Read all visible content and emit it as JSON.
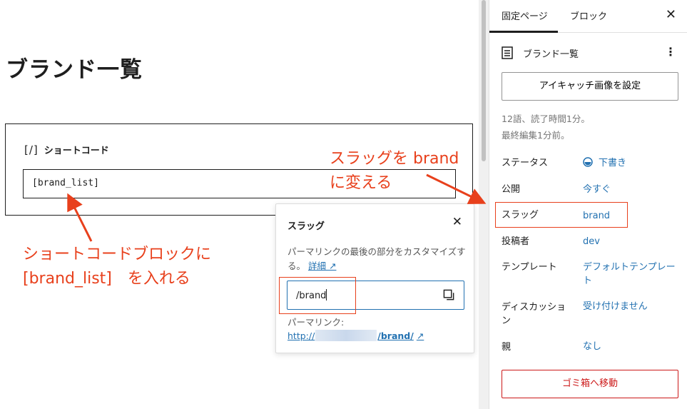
{
  "editor": {
    "page_title": "ブランド一覧",
    "shortcode_block": {
      "icon_text": "[/]",
      "label": "ショートコード",
      "value": "[brand_list]"
    }
  },
  "annotations": {
    "slug_note_line1": "スラッグを brand",
    "slug_note_line2": "に変える",
    "shortcode_note_line1": "ショートコードブロックに",
    "shortcode_note_line2": "[brand_list]　を入れる",
    "color": "#e8401c"
  },
  "slug_popover": {
    "title": "スラッグ",
    "close_icon": "close-icon",
    "description": "パーマリンクの最後の部分をカスタマイズする。",
    "details_link": "詳細 ↗",
    "input_value": "/brand",
    "permalink_label": "パーマリンク:",
    "permalink_prefix": "http://",
    "permalink_suffix": "/brand/",
    "external_arrow": "↗"
  },
  "sidebar": {
    "tabs": [
      "固定ページ",
      "ブロック"
    ],
    "active_tab": "固定ページ",
    "doc_title": "ブランド一覧",
    "featured_image_button": "アイキャッチ画像を設定",
    "word_count": "12語、読了時間1分。",
    "last_edited": "最終編集1分前。",
    "rows": [
      {
        "label": "ステータス",
        "value": "下書き"
      },
      {
        "label": "公開",
        "value": "今すぐ"
      },
      {
        "label": "スラッグ",
        "value": "brand"
      },
      {
        "label": "投稿者",
        "value": "dev"
      },
      {
        "label": "テンプレート",
        "value": "デフォルトテンプレート"
      },
      {
        "label": "ディスカッション",
        "value": "受け付けません"
      },
      {
        "label": "親",
        "value": "なし"
      }
    ],
    "trash_button": "ゴミ箱へ移動",
    "accent_color": "#2271b1",
    "danger_color": "#cc1818"
  }
}
